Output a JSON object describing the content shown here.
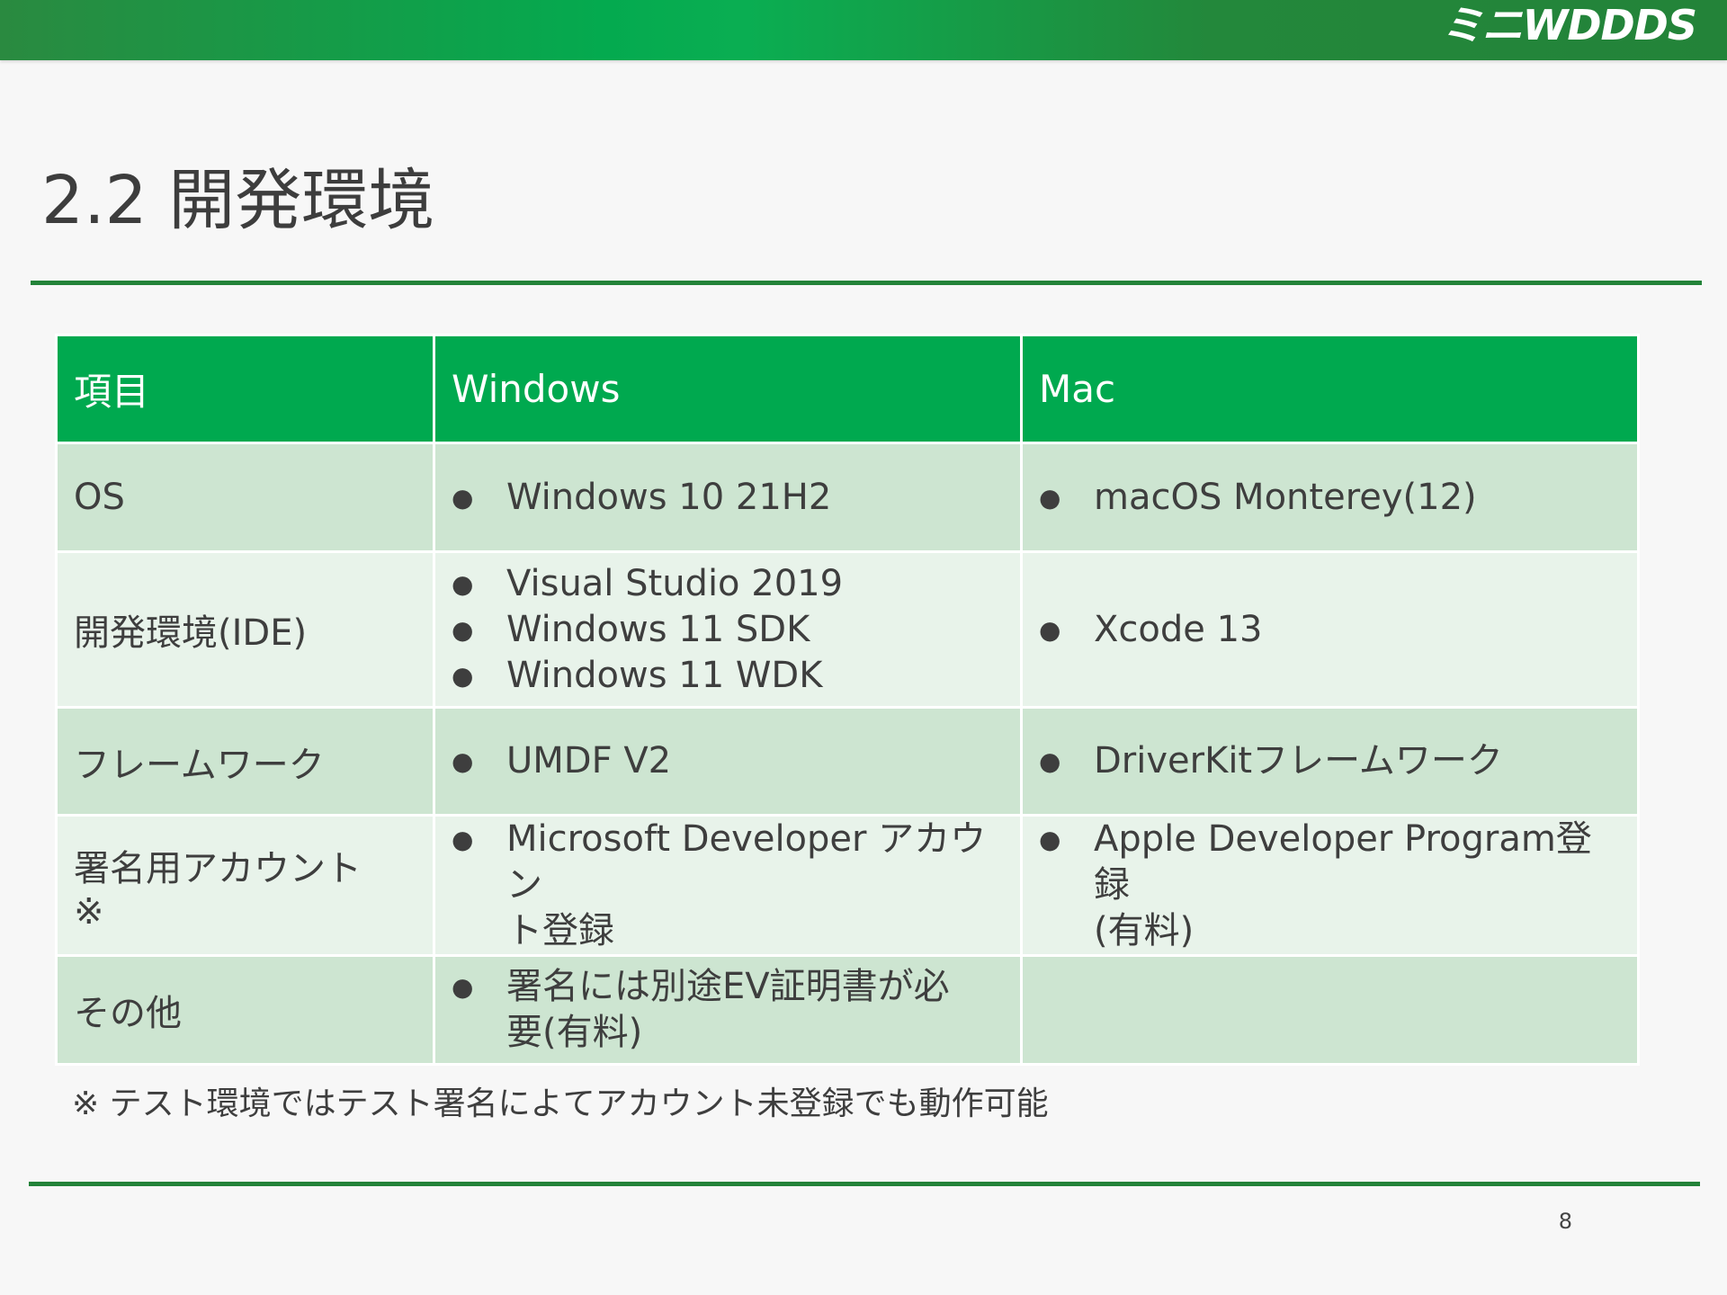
{
  "header": {
    "logo_text": "ミニWDDDS",
    "bar_color": "#238339",
    "accent_color": "#00a94f"
  },
  "slide": {
    "title": "2.2 開発環境",
    "page_number": "8"
  },
  "table": {
    "columns": [
      "項目",
      "Windows",
      "Mac"
    ],
    "rows": [
      {
        "label": [
          "OS"
        ],
        "windows": [
          "Windows 10 21H2"
        ],
        "mac": [
          "macOS Monterey(12)"
        ]
      },
      {
        "label": [
          "開発環境(IDE)"
        ],
        "windows": [
          "Visual Studio 2019",
          "Windows 11 SDK",
          "Windows 11 WDK"
        ],
        "mac": [
          "Xcode 13"
        ]
      },
      {
        "label": [
          "フレームワーク"
        ],
        "windows": [
          "UMDF V2"
        ],
        "mac": [
          "DriverKitフレームワーク"
        ]
      },
      {
        "label": [
          "署名用アカウント",
          "※"
        ],
        "windows": [
          "Microsoft Developer アカウン",
          "ト登録"
        ],
        "mac": [
          "Apple Developer Program登録",
          "(有料)"
        ]
      },
      {
        "label": [
          "その他"
        ],
        "windows": [
          "署名には別途EV証明書が必",
          "要(有料)"
        ],
        "mac": []
      }
    ]
  },
  "footnote": "※ テスト環境ではテスト署名によてアカウント未登録でも動作可能"
}
